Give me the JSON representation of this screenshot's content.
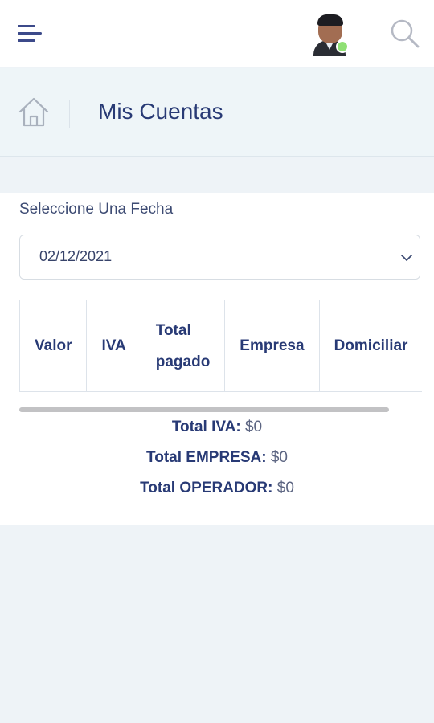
{
  "header": {
    "page_title": "Mis Cuentas"
  },
  "filter": {
    "label": "Seleccione Una Fecha",
    "selected_date": "02/12/2021"
  },
  "table": {
    "columns": [
      "Valor",
      "IVA",
      "Total pagado",
      "Empresa",
      "Domiciliar"
    ]
  },
  "totals": [
    {
      "label": "Total IVA:",
      "value": "$0"
    },
    {
      "label": "Total EMPRESA:",
      "value": "$0"
    },
    {
      "label": "Total OPERADOR:",
      "value": "$0"
    }
  ],
  "colors": {
    "primary_text": "#283a75",
    "online_status": "#8fe074",
    "header_bg": "#eef5f8"
  },
  "icons": [
    "menu-icon",
    "avatar",
    "search-icon",
    "home-icon",
    "chevron-down-icon"
  ]
}
